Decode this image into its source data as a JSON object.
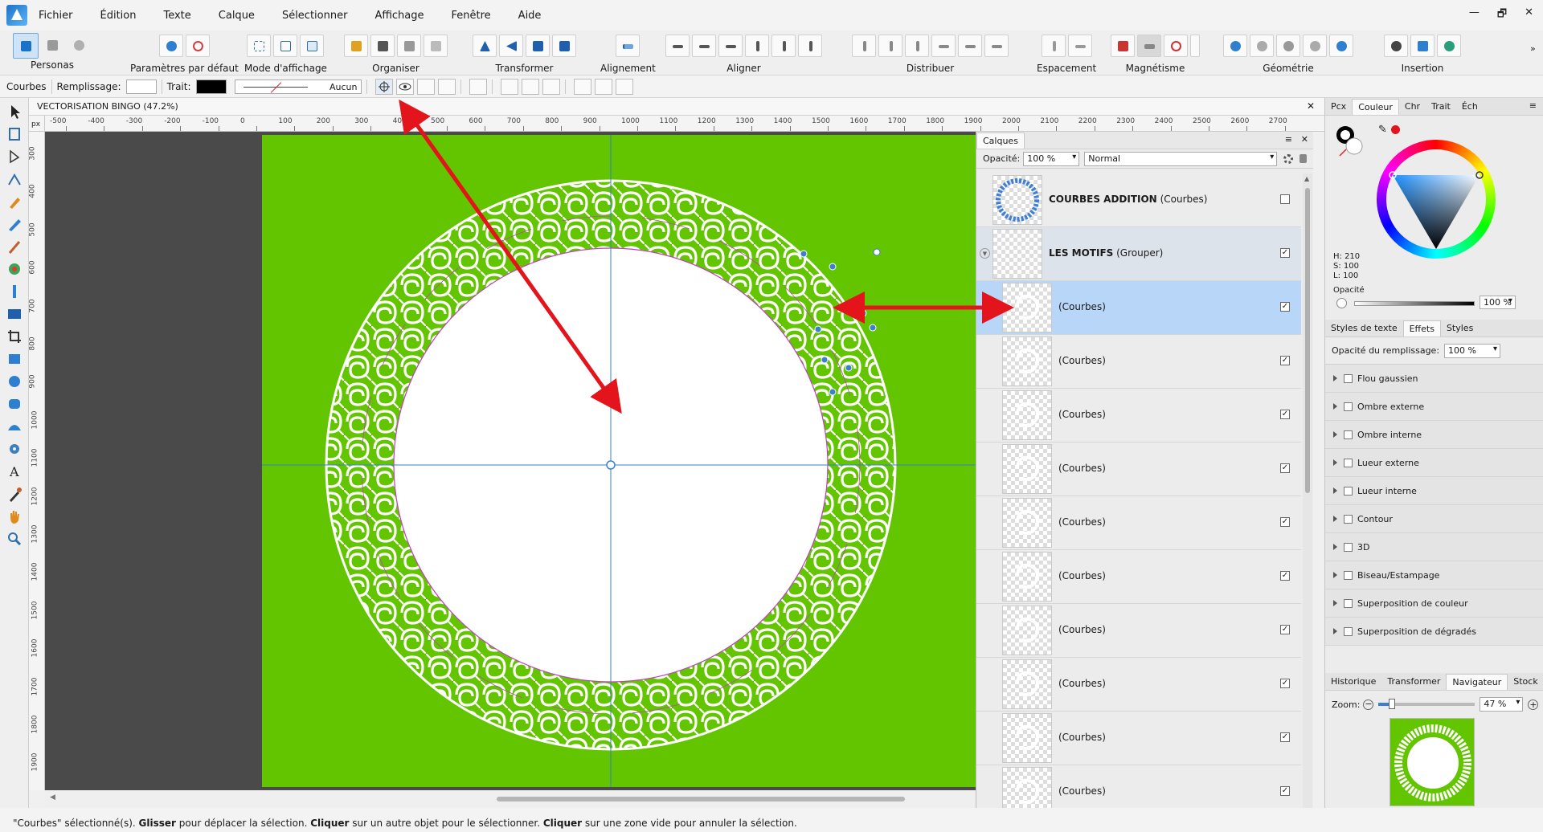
{
  "menubar": {
    "items": [
      "Fichier",
      "Édition",
      "Texte",
      "Calque",
      "Sélectionner",
      "Affichage",
      "Fenêtre",
      "Aide"
    ],
    "controls": [
      "—",
      "🗗",
      "✕"
    ]
  },
  "toolbar": {
    "personas": "Personas",
    "defaults": "Paramètres par défaut",
    "view_mode": "Mode d'affichage",
    "arrange": "Organiser",
    "transform": "Transformer",
    "alignment": "Alignement",
    "align": "Aligner",
    "distribute": "Distribuer",
    "spacing": "Espacement",
    "snapping": "Magnétisme",
    "geometry": "Géométrie",
    "insert": "Insertion"
  },
  "context": {
    "object_type": "Courbes",
    "fill_label": "Remplissage:",
    "stroke_label": "Trait:",
    "stroke_style": "Aucun",
    "fill_color": "#ffffff",
    "stroke_color": "#000000"
  },
  "document": {
    "title": "VECTORISATION BINGO (47.2%)",
    "ruler_unit": "px",
    "hruler_labels": [
      "-500",
      "-400",
      "-300",
      "-200",
      "-100",
      "0",
      "100",
      "200",
      "300",
      "400",
      "500",
      "600",
      "700",
      "800",
      "900",
      "1000",
      "1100",
      "1200",
      "1300",
      "1400",
      "1500",
      "1600",
      "1700",
      "1800",
      "1900",
      "2000",
      "2100",
      "2200",
      "2300",
      "2400",
      "2500",
      "2600",
      "2700"
    ],
    "vruler_labels": [
      "300",
      "400",
      "500",
      "600",
      "700",
      "800",
      "900",
      "1000",
      "1100",
      "1200",
      "1300",
      "1400",
      "1500",
      "1600",
      "1700",
      "1800",
      "1900"
    ],
    "artboard_color": "#63c400",
    "pasteboard_color": "#4a4a4a"
  },
  "status": {
    "p1": "\"Courbes\" sélectionné(s). ",
    "b1": "Glisser",
    "p2": " pour déplacer la sélection. ",
    "b2": "Cliquer",
    "p3": " sur un autre objet pour le sélectionner. ",
    "b3": "Cliquer",
    "p4": " sur une zone vide pour annuler la sélection."
  },
  "layers_panel": {
    "tab": "Calques",
    "opacity_label": "Opacité:",
    "opacity_value": "100 %",
    "blend_mode": "Normal",
    "rows": [
      {
        "name": "COURBES ADDITION",
        "type": "(Courbes)",
        "checked": false,
        "selected": false
      },
      {
        "name": "LES MOTIFS",
        "type": "(Grouper)",
        "checked": true,
        "selected": false
      },
      {
        "name": "",
        "type": "(Courbes)",
        "checked": true,
        "selected": true
      },
      {
        "name": "",
        "type": "(Courbes)",
        "checked": true,
        "selected": false
      },
      {
        "name": "",
        "type": "(Courbes)",
        "checked": true,
        "selected": false
      },
      {
        "name": "",
        "type": "(Courbes)",
        "checked": true,
        "selected": false
      },
      {
        "name": "",
        "type": "(Courbes)",
        "checked": true,
        "selected": false
      },
      {
        "name": "",
        "type": "(Courbes)",
        "checked": true,
        "selected": false
      },
      {
        "name": "",
        "type": "(Courbes)",
        "checked": true,
        "selected": false
      },
      {
        "name": "",
        "type": "(Courbes)",
        "checked": true,
        "selected": false
      },
      {
        "name": "",
        "type": "(Courbes)",
        "checked": true,
        "selected": false
      },
      {
        "name": "",
        "type": "(Courbes)",
        "checked": true,
        "selected": false
      }
    ]
  },
  "color_panel": {
    "tabs": [
      "Pcx",
      "Couleur",
      "Chr",
      "Trait",
      "Éch"
    ],
    "active_tab": "Couleur",
    "h": "H: 210",
    "s": "S: 100",
    "l": "L: 100",
    "opacity_label": "Opacité",
    "opacity_value": "100 %"
  },
  "effects_panel": {
    "tabs": [
      "Styles de texte",
      "Effets",
      "Styles"
    ],
    "active_tab": "Effets",
    "fill_opacity_label": "Opacité du remplissage:",
    "fill_opacity_value": "100 %",
    "effects": [
      "Flou gaussien",
      "Ombre externe",
      "Ombre interne",
      "Lueur externe",
      "Lueur interne",
      "Contour",
      "3D",
      "Biseau/Estampage",
      "Superposition de couleur",
      "Superposition de dégradés"
    ]
  },
  "navigator_panel": {
    "tabs": [
      "Historique",
      "Transformer",
      "Navigateur",
      "Stock"
    ],
    "active_tab": "Navigateur",
    "zoom_label": "Zoom:",
    "zoom_value": "47 %",
    "zoom_percent": 47
  },
  "colors": {
    "accent": "#3d7fd6",
    "annotation_arrow": "#e3141b",
    "selection_row": "#b8d7f8",
    "group_row": "#dde3ea"
  }
}
